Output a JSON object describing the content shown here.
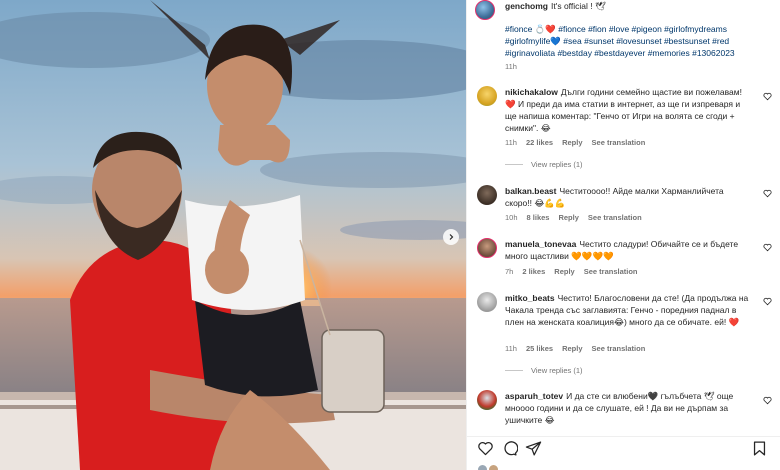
{
  "post": {
    "username": "genchomg",
    "caption": "It's official ! 🕊",
    "hashtags": "#fionce 💍❤️ #fionce #fion #love #pigeon #girlofmydreams #girlofmylife💙 #sea #sunset #lovesunset #bestsunset #red #igrinavoliata #bestday #bestdayever #memories #13062023",
    "time": "11h"
  },
  "comments": [
    {
      "username": "nikichakalow",
      "text": "Дълги години семейно щастие ви пожелавам! ❤️ И преди да има статии в интернет, аз ще ги изпреваря и ще напиша коментар: \"Генчо от Игри на волята се сгоди + снимки\". 😂",
      "time": "11h",
      "likes": "22 likes",
      "reply": "Reply",
      "translate": "See translation",
      "view_replies": "View replies (1)"
    },
    {
      "username": "balkan.beast",
      "text": "Честитоооо!! Айде малки Харманлийчета скоро!! 😂💪💪",
      "time": "10h",
      "likes": "8 likes",
      "reply": "Reply",
      "translate": "See translation"
    },
    {
      "username": "manuela_tonevaa",
      "text": "Честито сладури! Обичайте се и бъдете много щастливи 🧡🧡🧡🧡",
      "time": "7h",
      "likes": "2 likes",
      "reply": "Reply",
      "translate": "See translation"
    },
    {
      "username": "mitko_beats",
      "text": "Честито! Благословени да сте! (Да продължа на Чакала тренда със заглавията: Генчо - поредния паднал в плен на женската коалиция😂) много да се обичате. ей! ❤️",
      "time": "11h",
      "likes": "25 likes",
      "reply": "Reply",
      "translate": "See translation",
      "view_replies": "View replies (1)"
    },
    {
      "username": "asparuh_totev",
      "text": "И да сте си влюбени🖤 гълъбчета 🕊 още мноооо години и да се слушате, ей ! Да ви не дърпам за ушичките 😂"
    }
  ],
  "icons": {
    "verified": "verified-icon",
    "like": "heart-icon",
    "comment": "comment-icon",
    "share": "send-icon",
    "save": "bookmark-icon",
    "next": "chevron-right-icon"
  },
  "colors": {
    "link": "#00376b",
    "muted": "#737373",
    "heart_red": "#e0193c"
  }
}
